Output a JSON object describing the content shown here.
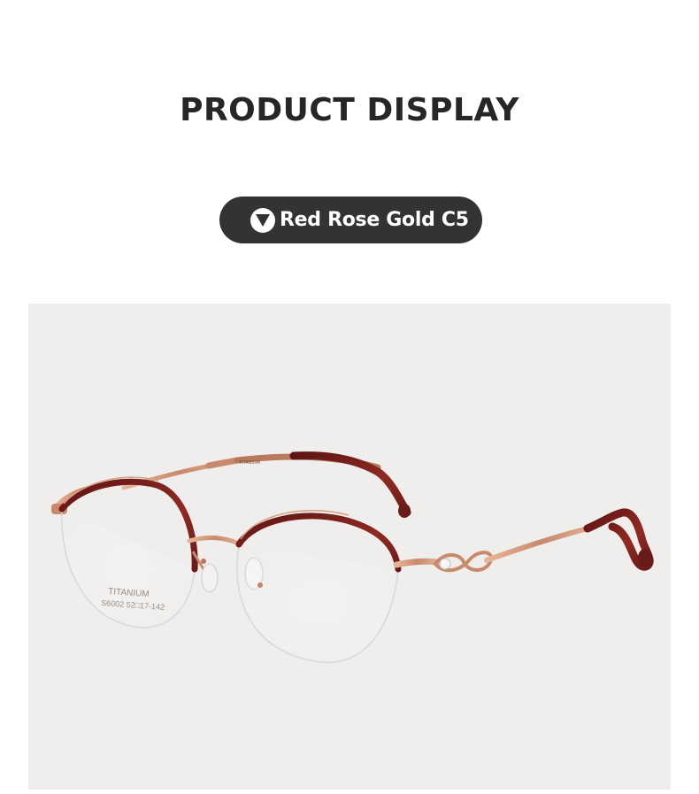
{
  "header": {
    "title": "PRODUCT DISPLAY"
  },
  "color_variant": {
    "label": "Red Rose Gold C5",
    "icon": "triangle-down-icon"
  },
  "product_photo": {
    "temple_print": "TITANIUM",
    "lens_print_line1": "TITANIUM",
    "lens_print_line2": "S6002 52□17-142"
  },
  "colors": {
    "title_text": "#262626",
    "pill_background": "#333333",
    "photo_background": "#efeeed",
    "rose_gold": "#d49a7c",
    "burgundy": "#7a1f1d"
  }
}
